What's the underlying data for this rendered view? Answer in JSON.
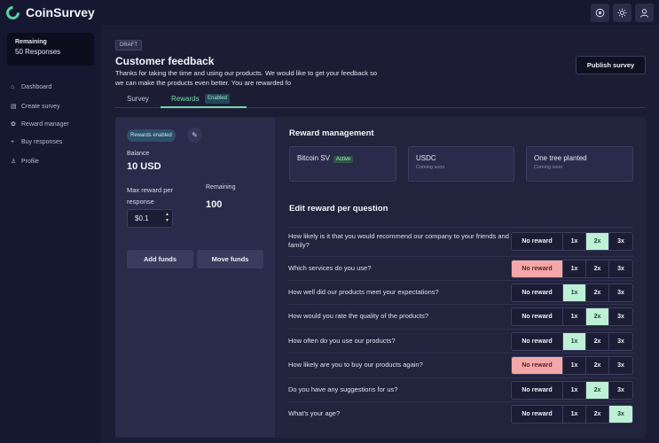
{
  "app": {
    "name": "CoinSurvey"
  },
  "topbar": {
    "icons": [
      "target-icon",
      "sun-icon",
      "user-icon"
    ]
  },
  "sidebar": {
    "remaining_title": "Remaining",
    "remaining_value": "50 Responses",
    "items": [
      {
        "label": "Dashboard",
        "icon": "home-icon"
      },
      {
        "label": "Create survey",
        "icon": "document-icon"
      },
      {
        "label": "Reward manager",
        "icon": "gift-icon"
      },
      {
        "label": "Buy responses",
        "icon": "plus-icon"
      },
      {
        "label": "Profile",
        "icon": "user-icon"
      }
    ]
  },
  "header": {
    "badge": "DRAFT",
    "title": "Customer feedback",
    "description": "Thanks for taking the time and using our products. We would like to get your feedback so we can make the products even better. You are rewarded fo",
    "publish_label": "Publish survey"
  },
  "tabs": {
    "survey": "Survey",
    "rewards": "Rewards",
    "rewards_badge": "Enabled"
  },
  "left": {
    "rewards_enabled": "Rewards enabled",
    "balance_label": "Balance",
    "balance_value": "10 USD",
    "max_reward_label": "Max reward per response",
    "max_reward_value": "$0.1",
    "remaining_label": "Remaining",
    "remaining_value": "100",
    "add_funds": "Add funds",
    "move_funds": "Move funds"
  },
  "reward_management": {
    "title": "Reward management",
    "options": [
      {
        "title": "Bitcoin SV",
        "badge": "Active",
        "sub": ""
      },
      {
        "title": "USDC",
        "badge": "",
        "sub": "Coming soon"
      },
      {
        "title": "One tree planted",
        "badge": "",
        "sub": "Coming soon"
      }
    ]
  },
  "edit": {
    "title": "Edit reward per question",
    "option_labels": [
      "No reward",
      "1x",
      "2x",
      "3x"
    ],
    "questions": [
      {
        "text": "How likely is it that you would recommend our company to your friends and family?",
        "selected": "2x"
      },
      {
        "text": "Which services do you use?",
        "selected": "No reward"
      },
      {
        "text": "How well did our products meet your expectations?",
        "selected": "1x"
      },
      {
        "text": "How would you rate the quality of the products?",
        "selected": "2x"
      },
      {
        "text": "How often do you use our products?",
        "selected": "1x"
      },
      {
        "text": "How likely are you to buy our products again?",
        "selected": "No reward"
      },
      {
        "text": "Do you have any suggestions for us?",
        "selected": "2x"
      },
      {
        "text": "What's your age?",
        "selected": "3x"
      }
    ]
  },
  "colors": {
    "accent": "#6fd9ab",
    "no_reward_selected": "#f4a7a8",
    "multiplier_selected": "#bdf0d4"
  }
}
